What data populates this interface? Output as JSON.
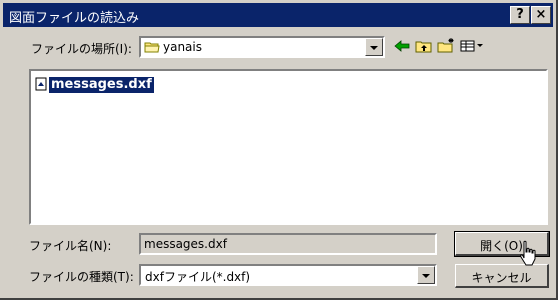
{
  "title": "図面ファイルの読込み",
  "title_buttons": {
    "help": "?",
    "close": "×"
  },
  "look_in": {
    "label": "ファイルの場所(I):",
    "value": "yanais"
  },
  "toolbar": {
    "icons": [
      "back-arrow-icon",
      "up-folder-icon",
      "new-folder-icon",
      "view-menu-icon"
    ]
  },
  "files": [
    {
      "name": "messages.dxf",
      "selected": true
    }
  ],
  "filename": {
    "label": "ファイル名(N):",
    "value": "messages.dxf"
  },
  "filetype": {
    "label": "ファイルの種類(T):",
    "value": "dxfファイル(*.dxf)"
  },
  "buttons": {
    "open": "開く(O)",
    "cancel": "キャンセル"
  },
  "colors": {
    "title_bar": "#0a246a",
    "face": "#d4d0c8",
    "selection": "#0a246a"
  }
}
